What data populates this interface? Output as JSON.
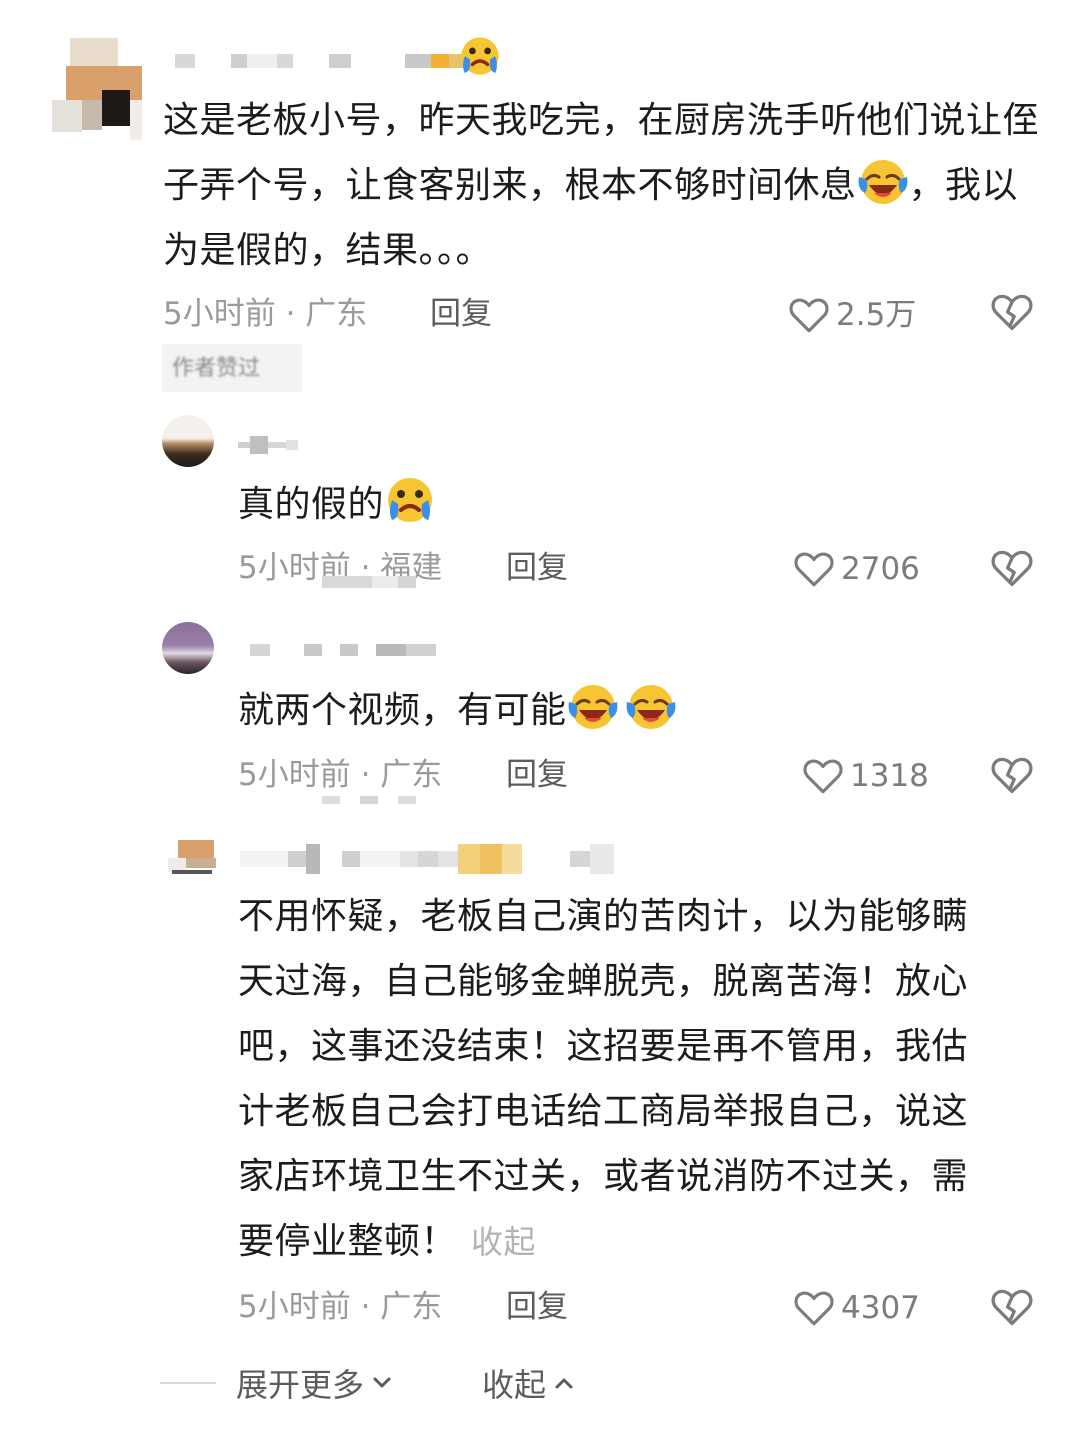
{
  "comments": [
    {
      "text": "这是老板小号，昨天我吃完，在厨房洗手听他们说让侄子弄个号，让食客别来，根本不够时间休息",
      "text_tail": "，我以为是假的，结果。。。",
      "emoji": "laughing-crying-emoji",
      "time_location": "5小时前 · 广东",
      "reply_label": "回复",
      "likes": "2.5万",
      "tag": "作者赞过"
    },
    {
      "text": "真的假的",
      "emoji": "crying-emoji",
      "time_location": "5小时前 · 福建",
      "reply_label": "回复",
      "likes": "2706"
    },
    {
      "text": "就两个视频，有可能",
      "emoji": "laughing-crying-emoji",
      "time_location": "5小时前 · 广东",
      "reply_label": "回复",
      "likes": "1318"
    },
    {
      "lines": [
        "不用怀疑，老板自己演的苦肉计，以为能够瞒",
        "天过海，自己能够金蝉脱壳，脱离苦海！放心",
        "吧，这事还没结束！这招要是再不管用，我估",
        "计老板自己会打电话给工商局举报自己，说这",
        "家店环境卫生不过关，或者说消防不过关，需"
      ],
      "last_line": "要停业整顿！",
      "collapse_inline": "收起",
      "time_location": "5小时前 · 广东",
      "reply_label": "回复",
      "likes": "4307"
    }
  ],
  "footer": {
    "expand_more": "展开更多",
    "collapse": "收起"
  },
  "colors": {
    "text": "#1c1c1c",
    "meta": "#9a9a9a",
    "reply": "#5c5c5c"
  }
}
